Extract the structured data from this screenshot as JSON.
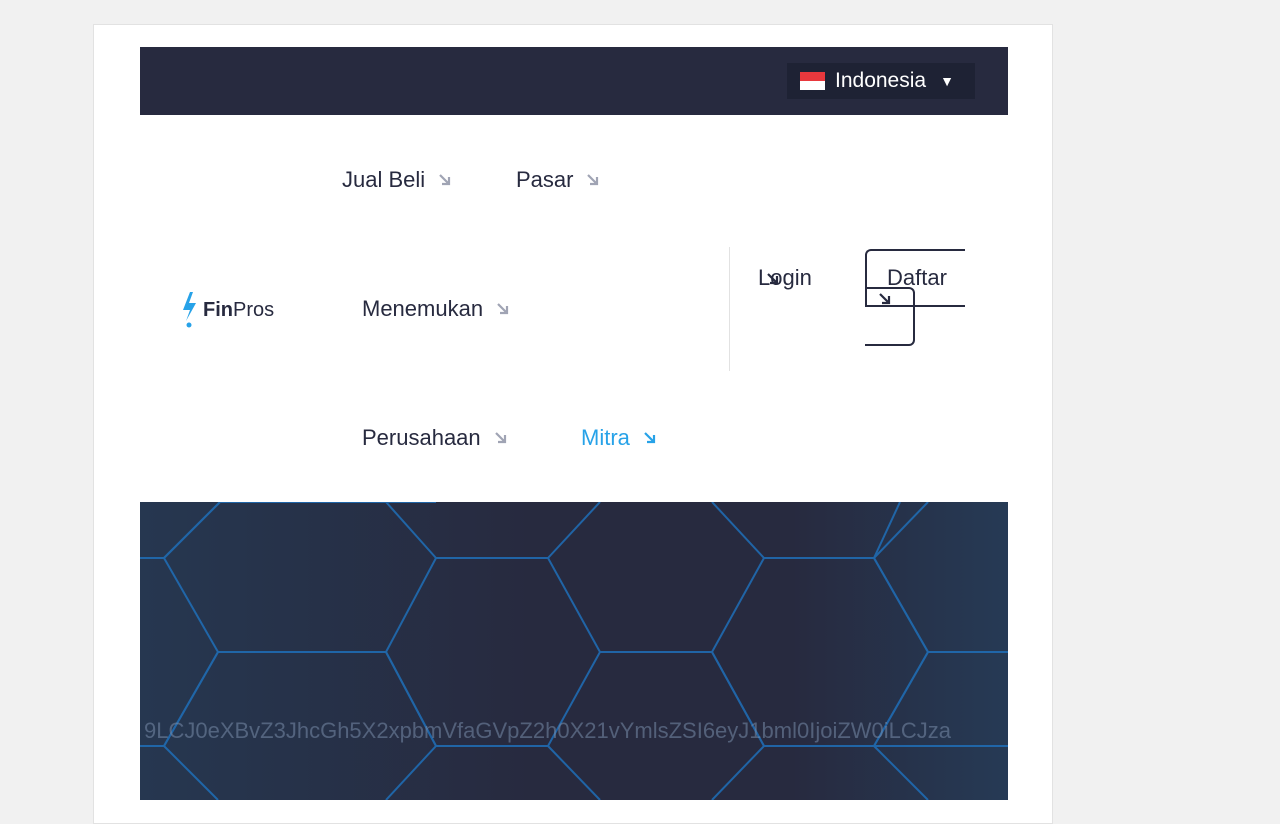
{
  "language_selector": {
    "label": "Indonesia",
    "flag_colors": [
      "#e8383d",
      "#ffffff"
    ]
  },
  "logo": {
    "part_bold": "Fin",
    "part_regular": "Pros",
    "accent_color": "#27a2e8"
  },
  "nav": {
    "items": [
      {
        "label": "Jual Beli",
        "active": false
      },
      {
        "label": "Pasar",
        "active": false
      },
      {
        "label": "Menemukan",
        "active": false
      },
      {
        "label": "Perusahaan",
        "active": false
      },
      {
        "label": "Mitra",
        "active": true
      }
    ]
  },
  "auth": {
    "login_label": "Login",
    "register_label": "Daftar"
  },
  "hero": {
    "token_text": "9LCJ0eXBvZ3JhcGh5X2xpbmVfaGVpZ2h0X21vYmlsZSI6eyJ1bml0IjoiZW0iLCJza"
  },
  "colors": {
    "dark": "#272a3f",
    "accent": "#27a2e8",
    "hex_line": "#1f6fb8"
  }
}
